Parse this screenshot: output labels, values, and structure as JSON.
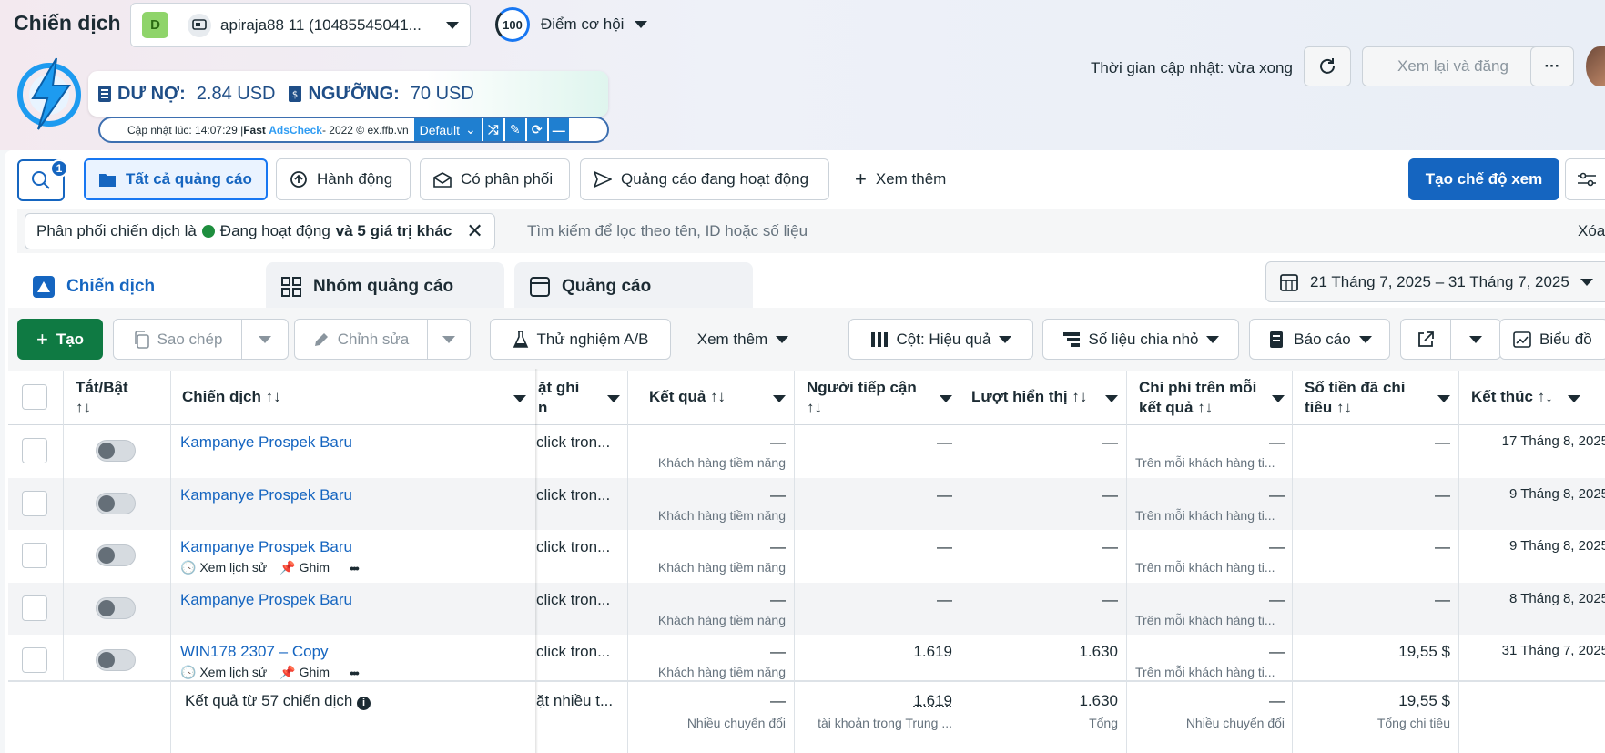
{
  "header": {
    "title": "Chiến dịch",
    "account_badge": "D",
    "account_name": "apiraja88 11 (10485545041...",
    "score_value": "100",
    "score_label": "Điểm cơ hội",
    "update_status": "Thời gian cập nhật: vừa xong",
    "review_publish": "Xem lại và đăng",
    "more": "···"
  },
  "adscheck": {
    "debt_label": "DƯ NỢ:",
    "debt_value": "2.84 USD",
    "threshold_label": "NGƯỠNG:",
    "threshold_value": "70 USD",
    "updated_prefix": "Cập nhật lúc: 14:07:29 | ",
    "brand_fast": "Fast",
    "brand_ads": "AdsCheck",
    "copyright": " - 2022 © ex.ffb.vn",
    "profile": "Default"
  },
  "filters": {
    "search_badge": "1",
    "quick": [
      "Tất cả quảng cáo",
      "Hành động",
      "Có phân phối",
      "Quảng cáo đang hoạt động"
    ],
    "see_more": "Xem thêm",
    "create_view": "Tạo chế độ xem",
    "chip_prefix": "Phân phối chiến dịch là",
    "chip_status": "Đang hoạt động",
    "chip_suffix": "và 5 giá trị khác",
    "search_placeholder": "Tìm kiếm để lọc theo tên, ID hoặc số liệu",
    "clear": "Xóa"
  },
  "tabs": [
    "Chiến dịch",
    "Nhóm quảng cáo",
    "Quảng cáo"
  ],
  "date_range": "21 Tháng 7, 2025 – 31 Tháng 7, 2025",
  "toolbar": {
    "create": "Tạo",
    "copy": "Sao chép",
    "edit": "Chỉnh sửa",
    "ab_test": "Thử nghiệm A/B",
    "see_more": "Xem thêm",
    "columns": "Cột: Hiệu quả",
    "breakdown": "Số liệu chia nhỏ",
    "reports": "Báo cáo",
    "chart": "Biểu đồ"
  },
  "columns": {
    "toggle": [
      "Tắt/Bật",
      "↑↓"
    ],
    "campaign": "Chiến dịch ↑↓",
    "attribution": [
      "ặt ghi",
      "n"
    ],
    "results": "Kết quả ↑↓",
    "reach": [
      "Người tiếp cận",
      "↑↓"
    ],
    "impressions": "Lượt hiển thị ↑↓",
    "cost_per_result": [
      "Chi phí trên mỗi",
      "kết quả ↑↓"
    ],
    "amount_spent": [
      "Số tiền đã chi",
      "tiêu ↑↓"
    ],
    "ends": "Kết thúc ↑↓"
  },
  "rows": [
    {
      "name": "Kampanye Prospek Baru",
      "attribution": "click tron...",
      "result": "—",
      "result_sub": "Khách hàng tiềm năng",
      "reach": "—",
      "impressions": "—",
      "cpr": "—",
      "cpr_sub": "Trên mỗi khách hàng ti...",
      "spent": "—",
      "ends": "17 Tháng 8, 2025",
      "show_tools": false
    },
    {
      "name": "Kampanye Prospek Baru",
      "attribution": "click tron...",
      "result": "—",
      "result_sub": "Khách hàng tiềm năng",
      "reach": "—",
      "impressions": "—",
      "cpr": "—",
      "cpr_sub": "Trên mỗi khách hàng ti...",
      "spent": "—",
      "ends": "9 Tháng 8, 2025",
      "show_tools": false
    },
    {
      "name": "Kampanye Prospek Baru",
      "attribution": "click tron...",
      "result": "—",
      "result_sub": "Khách hàng tiềm năng",
      "reach": "—",
      "impressions": "—",
      "cpr": "—",
      "cpr_sub": "Trên mỗi khách hàng ti...",
      "spent": "—",
      "ends": "9 Tháng 8, 2025",
      "show_tools": true
    },
    {
      "name": "Kampanye Prospek Baru",
      "attribution": "click tron...",
      "result": "—",
      "result_sub": "Khách hàng tiềm năng",
      "reach": "—",
      "impressions": "—",
      "cpr": "—",
      "cpr_sub": "Trên mỗi khách hàng ti...",
      "spent": "—",
      "ends": "8 Tháng 8, 2025",
      "show_tools": false
    },
    {
      "name": "WIN178 2307 – Copy",
      "attribution": "click tron...",
      "result": "—",
      "result_sub": "Khách hàng tiềm năng",
      "reach": "1.619",
      "impressions": "1.630",
      "cpr": "—",
      "cpr_sub": "Trên mỗi khách hàng ti...",
      "spent": "19,55 $",
      "ends": "31 Tháng 7, 2025",
      "show_tools": true
    }
  ],
  "row_tools": {
    "history": "Xem lịch sử",
    "pin": "Ghim",
    "more": "•••"
  },
  "summary": {
    "label": "Kết quả từ 57 chiến dịch",
    "attribution": "ặt nhiều t...",
    "result": "—",
    "result_sub": "Nhiều chuyển đổi",
    "reach": "1.619",
    "reach_sub": "tài khoản trong Trung ...",
    "impressions": "1.630",
    "impressions_sub": "Tổng",
    "cpr": "—",
    "cpr_sub": "Nhiều chuyển đổi",
    "spent": "19,55 $",
    "spent_sub": "Tổng chi tiêu"
  }
}
